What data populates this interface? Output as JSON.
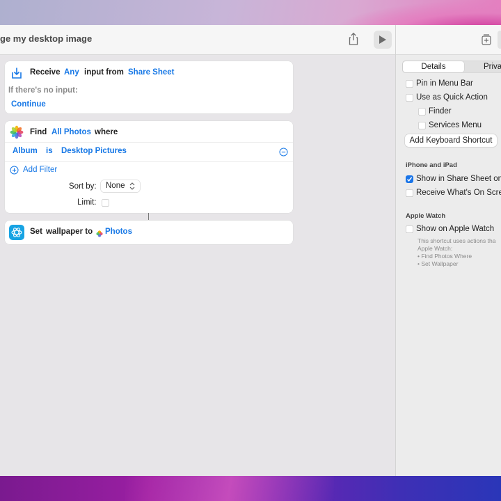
{
  "window": {
    "title": "ge my desktop image"
  },
  "actions": {
    "receive": {
      "verb": "Receive",
      "input_type": "Any",
      "middle": "input from",
      "source": "Share Sheet",
      "no_input_label": "If there's no input:",
      "no_input_value": "Continue"
    },
    "find": {
      "verb": "Find",
      "target": "All Photos",
      "where": "where",
      "filter_field": "Album",
      "filter_op": "is",
      "filter_value": "Desktop Pictures",
      "add_filter": "Add Filter",
      "sort_label": "Sort by:",
      "sort_value": "None",
      "limit_label": "Limit:",
      "limit_checked": false
    },
    "set_wallpaper": {
      "verb": "Set",
      "middle": "wallpaper to",
      "value": "Photos"
    }
  },
  "sidebar": {
    "tabs": [
      "Details",
      "Priva"
    ],
    "active_tab": "Details",
    "options": [
      {
        "label": "Pin in Menu Bar",
        "checked": false
      },
      {
        "label": "Use as Quick Action",
        "checked": false
      },
      {
        "label": "Finder",
        "checked": false
      },
      {
        "label": "Services Menu",
        "checked": false
      }
    ],
    "keyboard_shortcut_button": "Add Keyboard Shortcut",
    "iphone_section": {
      "title": "iPhone and iPad",
      "options": [
        {
          "label": "Show in Share Sheet on",
          "checked": true
        },
        {
          "label": "Receive What's On Scree",
          "checked": false
        }
      ]
    },
    "watch_section": {
      "title": "Apple Watch",
      "option": {
        "label": "Show on Apple Watch",
        "checked": false
      },
      "note_lines": [
        "This shortcut uses actions tha",
        "Apple Watch:",
        "• Find Photos Where",
        "• Set Wallpaper"
      ]
    }
  },
  "colors": {
    "accent": "#1778e6",
    "checkbox_on": "#1a75e8"
  }
}
